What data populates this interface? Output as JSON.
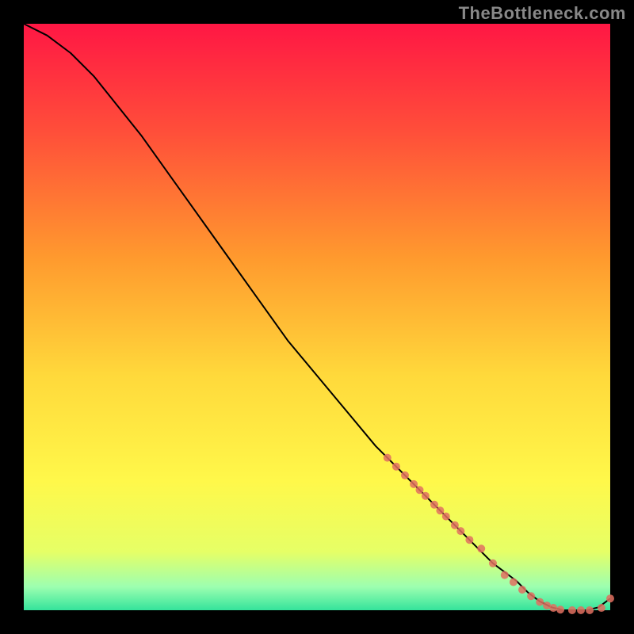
{
  "watermark": "TheBottleneck.com",
  "chart_data": {
    "type": "line",
    "title": "",
    "xlabel": "",
    "ylabel": "",
    "xlim": [
      0,
      100
    ],
    "ylim": [
      0,
      100
    ],
    "grid": false,
    "background_gradient": {
      "stops": [
        {
          "offset": 0.0,
          "color": "#ff1744"
        },
        {
          "offset": 0.18,
          "color": "#ff4d3a"
        },
        {
          "offset": 0.4,
          "color": "#ff9a2e"
        },
        {
          "offset": 0.6,
          "color": "#ffd93b"
        },
        {
          "offset": 0.78,
          "color": "#fff84a"
        },
        {
          "offset": 0.9,
          "color": "#e6ff66"
        },
        {
          "offset": 0.96,
          "color": "#9dffb0"
        },
        {
          "offset": 1.0,
          "color": "#34e39b"
        }
      ]
    },
    "series": [
      {
        "name": "bottleneck-curve",
        "type": "line",
        "color": "#000000",
        "x": [
          0,
          4,
          8,
          12,
          16,
          20,
          25,
          30,
          35,
          40,
          45,
          50,
          55,
          60,
          65,
          70,
          75,
          80,
          84,
          86,
          88,
          90,
          92,
          94,
          96,
          98,
          100
        ],
        "y": [
          100,
          98,
          95,
          91,
          86,
          81,
          74,
          67,
          60,
          53,
          46,
          40,
          34,
          28,
          23,
          18,
          13,
          8,
          5,
          3,
          1.5,
          0.5,
          0,
          0,
          0,
          0.5,
          2
        ]
      },
      {
        "name": "sample-dots",
        "type": "scatter",
        "color": "#e07060",
        "x": [
          62,
          63.5,
          65,
          66.5,
          67.5,
          68.5,
          70,
          71,
          72,
          73.5,
          74.5,
          76,
          78,
          80,
          82,
          83.5,
          85,
          86.5,
          88,
          89.2,
          90.3,
          91.5,
          93.5,
          95,
          96.5,
          98.5,
          100
        ],
        "y": [
          26,
          24.5,
          23,
          21.5,
          20.5,
          19.5,
          18,
          17,
          16,
          14.5,
          13.5,
          12,
          10.5,
          8,
          6,
          4.8,
          3.5,
          2.4,
          1.4,
          0.8,
          0.4,
          0.1,
          0,
          0,
          0,
          0.4,
          2
        ]
      }
    ]
  }
}
